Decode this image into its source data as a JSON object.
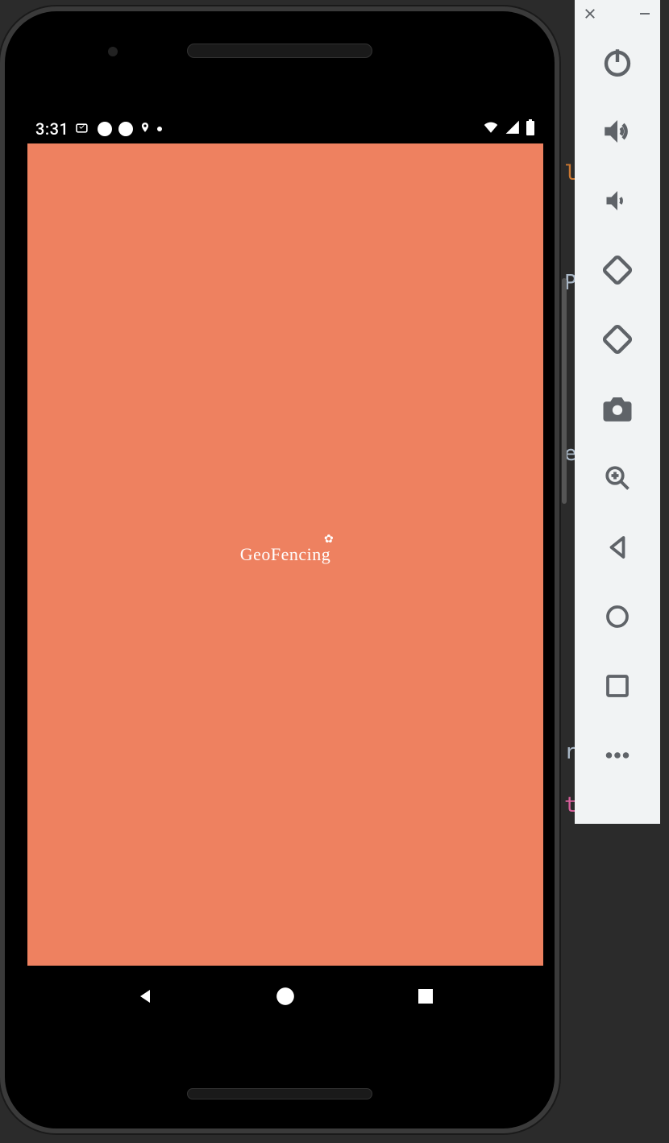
{
  "status_bar": {
    "time": "3:31",
    "icons_left": [
      "data-saver-icon",
      "circle-icon",
      "circle-icon",
      "location-icon",
      "dot-icon"
    ],
    "icons_right": [
      "wifi-icon",
      "signal-icon",
      "battery-icon"
    ]
  },
  "app": {
    "title": "GeoFencing",
    "background_color": "#ee8160"
  },
  "nav": {
    "back": "◀",
    "home": "●",
    "recent": "■"
  },
  "toolbar": {
    "top": {
      "close": "close-icon",
      "minimize": "minimize-icon"
    },
    "buttons": [
      "power-icon",
      "volume-up-icon",
      "volume-down-icon",
      "rotate-left-icon",
      "rotate-right-icon",
      "screenshot-icon",
      "zoom-in-icon",
      "back-icon",
      "home-icon",
      "overview-icon",
      "more-icon"
    ]
  },
  "bg_chars": {
    "c1": "l",
    "c2": "P",
    "c3": "e",
    "c4": "r",
    "c5": "t"
  }
}
